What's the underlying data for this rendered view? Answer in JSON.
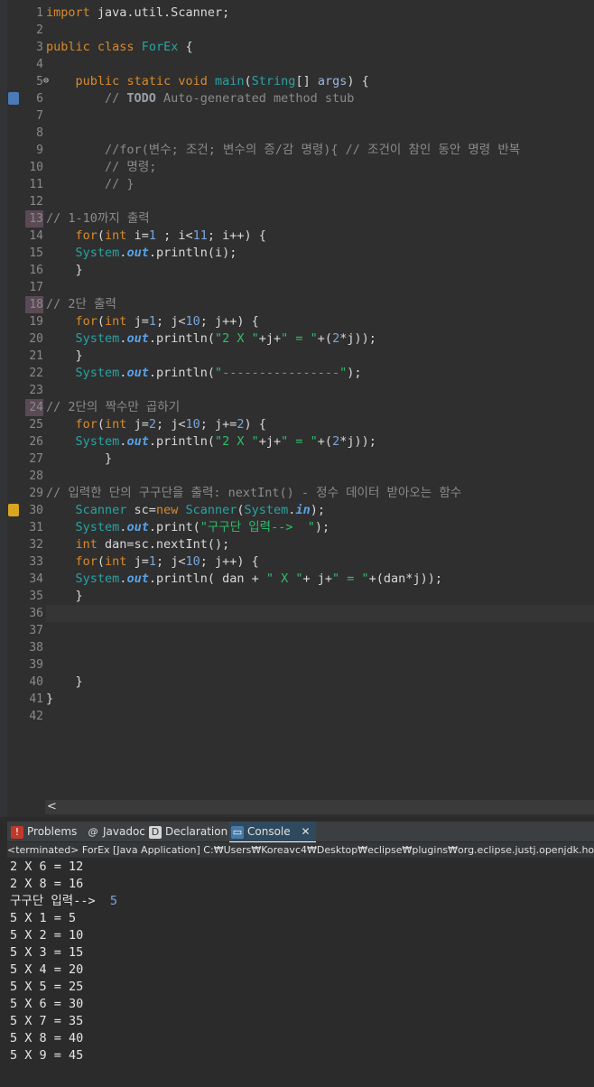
{
  "editor": {
    "line_numbers": [
      "1",
      "2",
      "3",
      "4",
      "5",
      "6",
      "7",
      "8",
      "9",
      "10",
      "11",
      "12",
      "13",
      "14",
      "15",
      "16",
      "17",
      "18",
      "19",
      "20",
      "21",
      "22",
      "23",
      "24",
      "25",
      "26",
      "27",
      "28",
      "29",
      "30",
      "31",
      "32",
      "33",
      "34",
      "35",
      "36",
      "37",
      "38",
      "39",
      "40",
      "41",
      "42"
    ],
    "lines": [
      [
        [
          "kw",
          "import"
        ],
        [
          "t",
          " java.util.Scanner;"
        ]
      ],
      [],
      [
        [
          "kw",
          "public"
        ],
        [
          "t",
          " "
        ],
        [
          "kw",
          "class"
        ],
        [
          "t",
          " "
        ],
        [
          "cls",
          "ForEx"
        ],
        [
          "t",
          " {"
        ]
      ],
      [],
      [
        [
          "t",
          "    "
        ],
        [
          "kw",
          "public"
        ],
        [
          "t",
          " "
        ],
        [
          "kw",
          "static"
        ],
        [
          "t",
          " "
        ],
        [
          "kw",
          "void"
        ],
        [
          "t",
          " "
        ],
        [
          "cls",
          "main"
        ],
        [
          "t",
          "("
        ],
        [
          "cls",
          "String"
        ],
        [
          "t",
          "[] "
        ],
        [
          "var",
          "args"
        ],
        [
          "t",
          ") {"
        ]
      ],
      [
        [
          "cm",
          "        // "
        ],
        [
          "todo",
          "TODO"
        ],
        [
          "cm",
          " Auto-generated method stub"
        ]
      ],
      [],
      [],
      [
        [
          "cm",
          "        //for(변수; 조건; 변수의 증/감 명령){ // 조건이 참인 동안 명령 반복"
        ]
      ],
      [
        [
          "cm",
          "        // 명령;"
        ]
      ],
      [
        [
          "cm",
          "        // }"
        ]
      ],
      [],
      [
        [
          "cm",
          "// 1-10까지 출력"
        ]
      ],
      [
        [
          "t",
          "    "
        ],
        [
          "kw",
          "for"
        ],
        [
          "t",
          "("
        ],
        [
          "kw",
          "int"
        ],
        [
          "t",
          " i="
        ],
        [
          "num",
          "1"
        ],
        [
          "t",
          " ; i<"
        ],
        [
          "num",
          "11"
        ],
        [
          "t",
          "; i++) {"
        ]
      ],
      [
        [
          "t",
          "    "
        ],
        [
          "cls",
          "System"
        ],
        [
          "t",
          "."
        ],
        [
          "fld",
          "out"
        ],
        [
          "t",
          ".println(i);"
        ]
      ],
      [
        [
          "t",
          "    }"
        ]
      ],
      [],
      [
        [
          "cm",
          "// 2단 출력"
        ]
      ],
      [
        [
          "t",
          "    "
        ],
        [
          "kw",
          "for"
        ],
        [
          "t",
          "("
        ],
        [
          "kw",
          "int"
        ],
        [
          "t",
          " j="
        ],
        [
          "num",
          "1"
        ],
        [
          "t",
          "; j<"
        ],
        [
          "num",
          "10"
        ],
        [
          "t",
          "; j++) {"
        ]
      ],
      [
        [
          "t",
          "    "
        ],
        [
          "cls",
          "System"
        ],
        [
          "t",
          "."
        ],
        [
          "fld",
          "out"
        ],
        [
          "t",
          ".println("
        ],
        [
          "str",
          "\"2 X \""
        ],
        [
          "t",
          "+j+"
        ],
        [
          "str",
          "\" = \""
        ],
        [
          "t",
          "+("
        ],
        [
          "num",
          "2"
        ],
        [
          "t",
          "*j));"
        ]
      ],
      [
        [
          "t",
          "    }"
        ]
      ],
      [
        [
          "t",
          "    "
        ],
        [
          "cls",
          "System"
        ],
        [
          "t",
          "."
        ],
        [
          "fld",
          "out"
        ],
        [
          "t",
          ".println("
        ],
        [
          "str",
          "\"----------------\""
        ],
        [
          "t",
          ");"
        ]
      ],
      [],
      [
        [
          "cm",
          "// 2단의 짝수만 곱하기"
        ]
      ],
      [
        [
          "t",
          "    "
        ],
        [
          "kw",
          "for"
        ],
        [
          "t",
          "("
        ],
        [
          "kw",
          "int"
        ],
        [
          "t",
          " j="
        ],
        [
          "num",
          "2"
        ],
        [
          "t",
          "; j<"
        ],
        [
          "num",
          "10"
        ],
        [
          "t",
          "; j+="
        ],
        [
          "num",
          "2"
        ],
        [
          "t",
          ") {"
        ]
      ],
      [
        [
          "t",
          "    "
        ],
        [
          "cls",
          "System"
        ],
        [
          "t",
          "."
        ],
        [
          "fld",
          "out"
        ],
        [
          "t",
          ".println("
        ],
        [
          "str",
          "\"2 X \""
        ],
        [
          "t",
          "+j+"
        ],
        [
          "str",
          "\" = \""
        ],
        [
          "t",
          "+("
        ],
        [
          "num",
          "2"
        ],
        [
          "t",
          "*j));"
        ]
      ],
      [
        [
          "t",
          "        }"
        ]
      ],
      [],
      [
        [
          "cm",
          "// 입력한 단의 구구단을 출력: nextInt() - 정수 데이터 받아오는 함수"
        ]
      ],
      [
        [
          "t",
          "    "
        ],
        [
          "cls",
          "Scanner"
        ],
        [
          "t",
          " sc="
        ],
        [
          "kw",
          "new"
        ],
        [
          "t",
          " "
        ],
        [
          "cls",
          "Scanner"
        ],
        [
          "t",
          "("
        ],
        [
          "cls",
          "System"
        ],
        [
          "t",
          "."
        ],
        [
          "fld",
          "in"
        ],
        [
          "t",
          ");"
        ]
      ],
      [
        [
          "t",
          "    "
        ],
        [
          "cls",
          "System"
        ],
        [
          "t",
          "."
        ],
        [
          "fld",
          "out"
        ],
        [
          "t",
          ".print("
        ],
        [
          "str",
          "\"구구단 입력-->  \""
        ],
        [
          "t",
          ");"
        ]
      ],
      [
        [
          "t",
          "    "
        ],
        [
          "kw",
          "int"
        ],
        [
          "t",
          " dan=sc.nextInt();"
        ]
      ],
      [
        [
          "t",
          "    "
        ],
        [
          "kw",
          "for"
        ],
        [
          "t",
          "("
        ],
        [
          "kw",
          "int"
        ],
        [
          "t",
          " j="
        ],
        [
          "num",
          "1"
        ],
        [
          "t",
          "; j<"
        ],
        [
          "num",
          "10"
        ],
        [
          "t",
          "; j++) {"
        ]
      ],
      [
        [
          "t",
          "    "
        ],
        [
          "cls",
          "System"
        ],
        [
          "t",
          "."
        ],
        [
          "fld",
          "out"
        ],
        [
          "t",
          ".println( dan + "
        ],
        [
          "str",
          "\" X \""
        ],
        [
          "t",
          "+ j+"
        ],
        [
          "str",
          "\" = \""
        ],
        [
          "t",
          "+(dan*j));"
        ]
      ],
      [
        [
          "t",
          "    }"
        ]
      ],
      [],
      [],
      [],
      [],
      [
        [
          "t",
          "    }"
        ]
      ],
      [
        [
          "t",
          "}"
        ]
      ],
      []
    ],
    "scroll_arrow": "<"
  },
  "bottom_panel": {
    "tabs": [
      {
        "label": "Problems",
        "icon": "problems-icon"
      },
      {
        "label": "Javadoc",
        "icon": "javadoc-icon"
      },
      {
        "label": "Declaration",
        "icon": "declaration-icon"
      },
      {
        "label": "Console",
        "icon": "console-icon"
      }
    ],
    "close_glyph": "✕",
    "status_line": "<terminated> ForEx [Java Application] C:₩Users₩Koreavc4₩Desktop₩eclipse₩plugins₩org.eclipse.justj.openjdk.hotspot.j",
    "console_lines": [
      {
        "text": "2 X 6 = 12"
      },
      {
        "text": "2 X 8 = 16"
      },
      {
        "text": "구구단 입력-->  ",
        "input": "5"
      },
      {
        "text": "5 X 1 = 5"
      },
      {
        "text": "5 X 2 = 10"
      },
      {
        "text": "5 X 3 = 15"
      },
      {
        "text": "5 X 4 = 20"
      },
      {
        "text": "5 X 5 = 25"
      },
      {
        "text": "5 X 6 = 30"
      },
      {
        "text": "5 X 7 = 35"
      },
      {
        "text": "5 X 8 = 40"
      },
      {
        "text": "5 X 9 = 45"
      }
    ]
  }
}
